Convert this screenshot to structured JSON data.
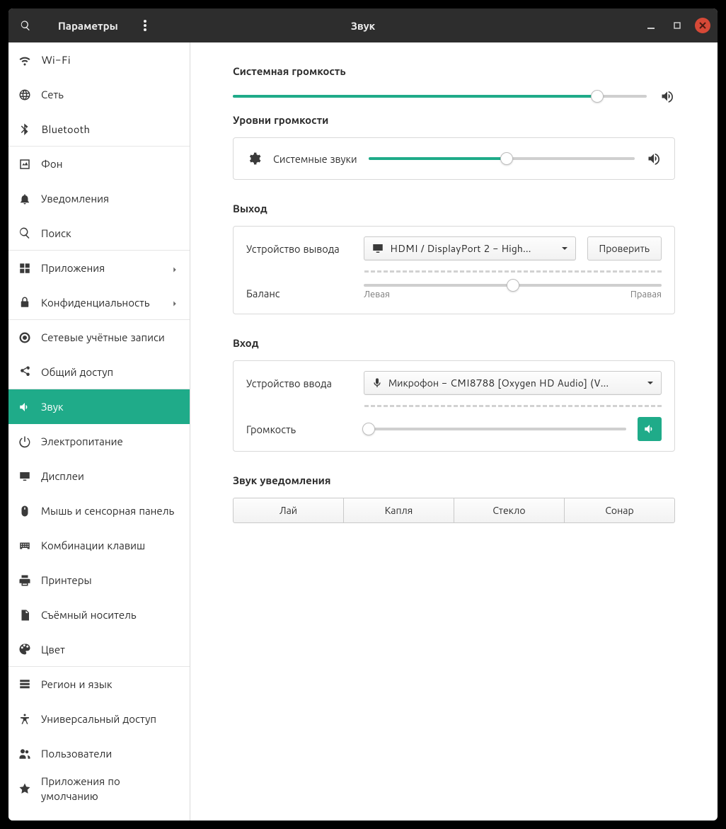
{
  "header": {
    "left_title": "Параметры",
    "center_title": "Звук"
  },
  "sidebar": {
    "items": [
      {
        "label": "Wi-Fi",
        "icon": "wifi"
      },
      {
        "label": "Сеть",
        "icon": "globe"
      },
      {
        "label": "Bluetooth",
        "icon": "bluetooth",
        "sep": true
      },
      {
        "label": "Фон",
        "icon": "wallpaper"
      },
      {
        "label": "Уведомления",
        "icon": "bell"
      },
      {
        "label": "Поиск",
        "icon": "search",
        "sep": true
      },
      {
        "label": "Приложения",
        "icon": "grid",
        "chevron": true
      },
      {
        "label": "Конфиденциальность",
        "icon": "privacy",
        "chevron": true,
        "sep": true
      },
      {
        "label": "Сетевые учётные записи",
        "icon": "target"
      },
      {
        "label": "Общий доступ",
        "icon": "share",
        "sep": true
      },
      {
        "label": "Звук",
        "icon": "sound",
        "active": true
      },
      {
        "label": "Электропитание",
        "icon": "power"
      },
      {
        "label": "Дисплеи",
        "icon": "display"
      },
      {
        "label": "Мышь и сенсорная панель",
        "icon": "mouse"
      },
      {
        "label": "Комбинации клавиш",
        "icon": "keyboard"
      },
      {
        "label": "Принтеры",
        "icon": "printer"
      },
      {
        "label": "Съёмный носитель",
        "icon": "media"
      },
      {
        "label": "Цвет",
        "icon": "color",
        "sep": true
      },
      {
        "label": "Регион и язык",
        "icon": "region"
      },
      {
        "label": "Универсальный доступ",
        "icon": "access"
      },
      {
        "label": "Пользователи",
        "icon": "users"
      },
      {
        "label": "Приложения по умолчанию",
        "icon": "star"
      }
    ]
  },
  "sections": {
    "system_volume": {
      "title": "Системная громкость",
      "value": 88
    },
    "levels": {
      "title": "Уровни громкости",
      "system_sounds_label": "Системные звуки",
      "system_sounds_value": 52
    },
    "output": {
      "title": "Выход",
      "device_label": "Устройство вывода",
      "device_value": "HDMI / DisplayPort 2 - High…",
      "test_label": "Проверить",
      "balance_label": "Баланс",
      "balance_left": "Левая",
      "balance_right": "Правая",
      "balance_value": 50
    },
    "input": {
      "title": "Вход",
      "device_label": "Устройство ввода",
      "device_value": "Микрофон - CMI8788 [Oxygen HD Audio] (V…",
      "volume_label": "Громкость",
      "volume_value": 0
    },
    "alert": {
      "title": "Звук уведомления",
      "options": [
        "Лай",
        "Капля",
        "Стекло",
        "Сонар"
      ]
    }
  },
  "colors": {
    "accent": "#1fab89"
  }
}
